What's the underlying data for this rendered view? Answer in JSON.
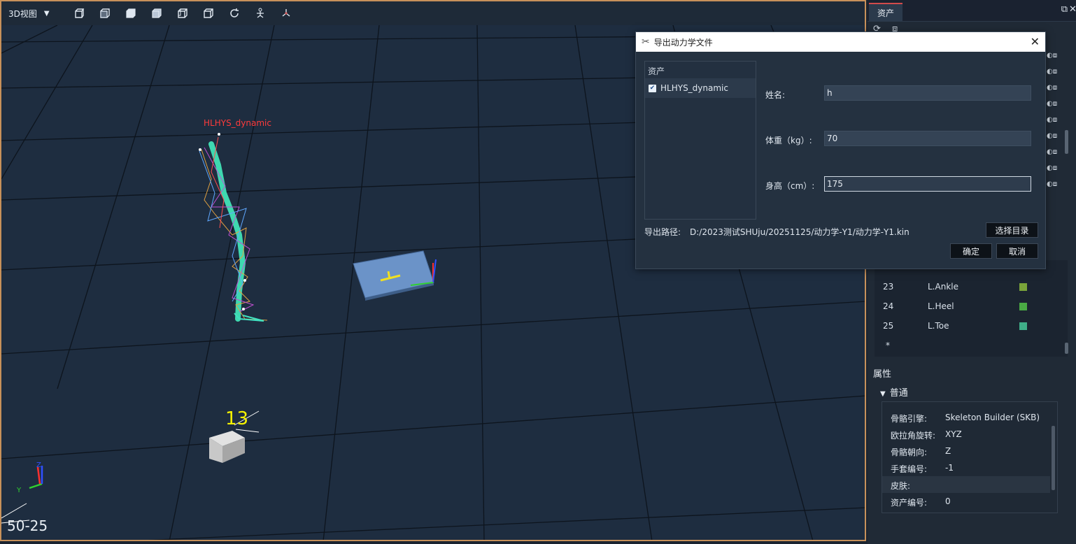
{
  "viewport": {
    "view_label": "3D视图",
    "fps": "50-25",
    "model_label": "HLHYS_dynamic",
    "marker_label": "13",
    "toolbar_icons": [
      "cube-front-icon",
      "cube-side-icon",
      "cube-top-icon",
      "cube-iso-icon",
      "cube-back-icon",
      "cube-right-icon",
      "refresh-icon",
      "skeleton-icon",
      "axes-icon"
    ]
  },
  "right_panel": {
    "tab": "资产",
    "joints": [
      {
        "num": "23",
        "name": "L.Ankle",
        "color": "#7aa43a"
      },
      {
        "num": "24",
        "name": "L.Heel",
        "color": "#4aaa44"
      },
      {
        "num": "25",
        "name": "L.Toe",
        "color": "#3fae88"
      },
      {
        "num": "*",
        "name": "",
        "color": ""
      }
    ],
    "props_title": "属性",
    "group": "普通",
    "props": [
      {
        "k": "骨骼引擎:",
        "v": "Skeleton Builder (SKB)"
      },
      {
        "k": "欧拉角旋转:",
        "v": "XYZ"
      },
      {
        "k": "骨骼朝向:",
        "v": "Z"
      },
      {
        "k": "手套编号:",
        "v": "-1"
      },
      {
        "k": "皮肤:",
        "v": ""
      },
      {
        "k": "资产编号:",
        "v": "0"
      }
    ]
  },
  "dialog": {
    "title": "导出动力学文件",
    "assets_header": "资产",
    "asset_item": "HLHYS_dynamic",
    "name_label": "姓名:",
    "name_value": "h",
    "weight_label": "体重（kg）:",
    "weight_value": "70",
    "height_label": "身高（cm）:",
    "height_value": "175",
    "path_label": "导出路径:",
    "path_value": "D:/2023测试SHUju/20251125/动力学-Y1/动力学-Y1.kin",
    "choose_dir": "选择目录",
    "ok": "确定",
    "cancel": "取消"
  }
}
